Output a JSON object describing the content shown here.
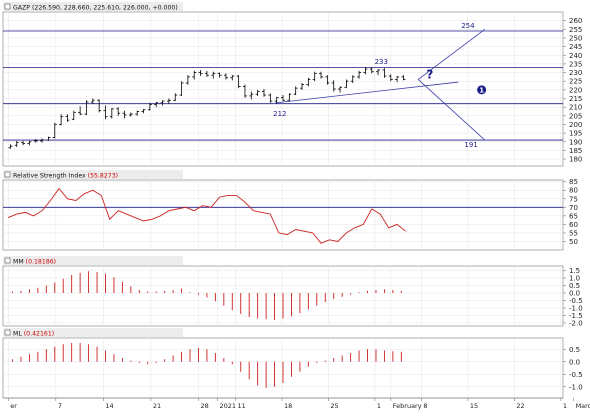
{
  "colors": {
    "background": "#ffffff",
    "grid": "#e6e6e6",
    "border": "#7a7a7a",
    "price_bar": "#000000",
    "level_line": "#1c1c8a",
    "trendline": "#3a3aa8",
    "rsi_line": "#cc1f1f",
    "histogram": "#cc1f1f",
    "annotation_text": "#1c1c8a",
    "header_bg": "#ececec",
    "header_value": "#cc0000"
  },
  "chart_data": [
    {
      "type": "ohlc",
      "pane": "price",
      "header_name": "GAZP",
      "header_values": "(226.590, 228.660, 225.610, 226.000, +0.000)",
      "ylim": [
        176,
        265
      ],
      "yticks": [
        180,
        185,
        190,
        195,
        200,
        205,
        210,
        215,
        220,
        225,
        230,
        235,
        240,
        245,
        250,
        255,
        260
      ],
      "horizontal_levels": [
        191,
        212,
        233,
        254
      ],
      "annotations": [
        {
          "text": "254",
          "x": 24.5,
          "y": 257
        },
        {
          "text": "233",
          "x": 16.3,
          "y": 236
        },
        {
          "text": "212",
          "x": 6.7,
          "y": 206
        },
        {
          "text": "191",
          "x": 24.8,
          "y": 188
        },
        {
          "text": "?",
          "x": 20.9,
          "y": 229,
          "kind": "question-mark"
        },
        {
          "text": "1",
          "x": 25.8,
          "y": 220,
          "kind": "circled-number"
        }
      ],
      "trendlines": [
        {
          "from": [
            6.3,
            212.5
          ],
          "to": [
            23.6,
            224.5
          ]
        },
        {
          "from": [
            19.8,
            226
          ],
          "to": [
            26.1,
            255
          ]
        },
        {
          "from": [
            19.8,
            226
          ],
          "to": [
            26.1,
            191
          ]
        }
      ],
      "bars": [
        {
          "x": -18.8,
          "open": 186.5,
          "high": 188.5,
          "low": 186.0,
          "close": 187.5
        },
        {
          "x": -18.2,
          "open": 188.0,
          "high": 190.5,
          "low": 187.0,
          "close": 189.5
        },
        {
          "x": -17.6,
          "open": 189.5,
          "high": 190.5,
          "low": 188.0,
          "close": 189.0
        },
        {
          "x": -17.0,
          "open": 189.0,
          "high": 190.5,
          "low": 188.0,
          "close": 190.0
        },
        {
          "x": -16.4,
          "open": 190.5,
          "high": 191.5,
          "low": 189.5,
          "close": 190.5
        },
        {
          "x": -15.8,
          "open": 190.5,
          "high": 192.0,
          "low": 189.5,
          "close": 191.0
        },
        {
          "x": -15.2,
          "open": 191.0,
          "high": 193.0,
          "low": 190.5,
          "close": 192.5
        },
        {
          "x": -14.6,
          "open": 192.5,
          "high": 201.0,
          "low": 192.0,
          "close": 200.0
        },
        {
          "x": -14.0,
          "open": 200.0,
          "high": 206.0,
          "low": 199.5,
          "close": 204.5
        },
        {
          "x": -13.4,
          "open": 204.5,
          "high": 206.0,
          "low": 201.5,
          "close": 202.5
        },
        {
          "x": -12.8,
          "open": 203.0,
          "high": 208.0,
          "low": 202.5,
          "close": 207.0
        },
        {
          "x": -12.2,
          "open": 207.0,
          "high": 210.5,
          "low": 205.5,
          "close": 206.0
        },
        {
          "x": -11.6,
          "open": 206.0,
          "high": 214.0,
          "low": 205.5,
          "close": 213.0
        },
        {
          "x": -11.0,
          "open": 213.0,
          "high": 215.0,
          "low": 212.0,
          "close": 214.0
        },
        {
          "x": -10.4,
          "open": 214.0,
          "high": 214.5,
          "low": 207.0,
          "close": 208.0
        },
        {
          "x": -9.8,
          "open": 208.0,
          "high": 211.0,
          "low": 203.0,
          "close": 204.5
        },
        {
          "x": -9.2,
          "open": 204.5,
          "high": 209.5,
          "low": 203.5,
          "close": 209.0
        },
        {
          "x": -8.6,
          "open": 209.0,
          "high": 210.0,
          "low": 205.0,
          "close": 206.5
        },
        {
          "x": -8.0,
          "open": 206.5,
          "high": 208.0,
          "low": 203.5,
          "close": 205.5
        },
        {
          "x": -7.4,
          "open": 205.5,
          "high": 207.0,
          "low": 204.5,
          "close": 206.0
        },
        {
          "x": -6.8,
          "open": 206.0,
          "high": 208.0,
          "low": 205.0,
          "close": 207.5
        },
        {
          "x": -6.2,
          "open": 207.5,
          "high": 209.0,
          "low": 206.5,
          "close": 208.5
        },
        {
          "x": -5.6,
          "open": 208.5,
          "high": 212.5,
          "low": 208.0,
          "close": 211.5
        },
        {
          "x": -5.0,
          "open": 211.5,
          "high": 213.0,
          "low": 210.0,
          "close": 212.5
        },
        {
          "x": -4.4,
          "open": 212.5,
          "high": 214.0,
          "low": 211.0,
          "close": 213.5
        },
        {
          "x": -3.8,
          "open": 213.5,
          "high": 215.0,
          "low": 212.0,
          "close": 214.0
        },
        {
          "x": -3.2,
          "open": 214.0,
          "high": 218.0,
          "low": 213.5,
          "close": 217.0
        },
        {
          "x": -2.6,
          "open": 217.0,
          "high": 225.0,
          "low": 216.5,
          "close": 224.0
        },
        {
          "x": -2.0,
          "open": 224.0,
          "high": 228.5,
          "low": 223.0,
          "close": 227.5
        },
        {
          "x": -1.4,
          "open": 227.5,
          "high": 231.0,
          "low": 226.0,
          "close": 230.0
        },
        {
          "x": -0.8,
          "open": 230.0,
          "high": 231.5,
          "low": 228.0,
          "close": 229.5
        },
        {
          "x": -0.2,
          "open": 229.5,
          "high": 231.0,
          "low": 227.5,
          "close": 228.5
        },
        {
          "x": 0.4,
          "open": 228.5,
          "high": 230.5,
          "low": 226.5,
          "close": 229.5
        },
        {
          "x": 1.0,
          "open": 229.5,
          "high": 230.0,
          "low": 227.0,
          "close": 228.5
        },
        {
          "x": 1.6,
          "open": 228.5,
          "high": 229.5,
          "low": 226.0,
          "close": 227.0
        },
        {
          "x": 2.2,
          "open": 227.0,
          "high": 228.5,
          "low": 225.5,
          "close": 228.0
        },
        {
          "x": 2.8,
          "open": 228.0,
          "high": 228.5,
          "low": 221.0,
          "close": 222.0
        },
        {
          "x": 3.4,
          "open": 222.0,
          "high": 223.0,
          "low": 215.5,
          "close": 216.5
        },
        {
          "x": 4.0,
          "open": 216.5,
          "high": 219.0,
          "low": 214.5,
          "close": 217.5
        },
        {
          "x": 4.6,
          "open": 217.5,
          "high": 220.0,
          "low": 216.5,
          "close": 219.0
        },
        {
          "x": 5.2,
          "open": 219.0,
          "high": 220.5,
          "low": 216.0,
          "close": 217.0
        },
        {
          "x": 5.8,
          "open": 217.0,
          "high": 218.0,
          "low": 212.5,
          "close": 213.5
        },
        {
          "x": 6.4,
          "open": 213.5,
          "high": 216.0,
          "low": 212.0,
          "close": 215.5
        },
        {
          "x": 7.0,
          "open": 215.5,
          "high": 217.0,
          "low": 213.5,
          "close": 214.0
        },
        {
          "x": 7.6,
          "open": 214.0,
          "high": 218.0,
          "low": 213.5,
          "close": 217.5
        },
        {
          "x": 8.2,
          "open": 217.5,
          "high": 222.0,
          "low": 217.0,
          "close": 221.0
        },
        {
          "x": 8.8,
          "open": 221.0,
          "high": 224.0,
          "low": 220.0,
          "close": 223.0
        },
        {
          "x": 9.4,
          "open": 223.0,
          "high": 227.0,
          "low": 222.0,
          "close": 226.0
        },
        {
          "x": 10.0,
          "open": 226.0,
          "high": 230.5,
          "low": 225.0,
          "close": 229.5
        },
        {
          "x": 10.6,
          "open": 229.5,
          "high": 230.5,
          "low": 226.5,
          "close": 227.5
        },
        {
          "x": 11.2,
          "open": 227.5,
          "high": 228.5,
          "low": 223.0,
          "close": 224.0
        },
        {
          "x": 11.8,
          "open": 224.0,
          "high": 225.5,
          "low": 219.0,
          "close": 220.5
        },
        {
          "x": 12.4,
          "open": 220.5,
          "high": 222.0,
          "low": 218.5,
          "close": 221.5
        },
        {
          "x": 13.0,
          "open": 221.5,
          "high": 226.0,
          "low": 221.0,
          "close": 225.0
        },
        {
          "x": 13.6,
          "open": 225.0,
          "high": 228.5,
          "low": 224.0,
          "close": 227.5
        },
        {
          "x": 14.2,
          "open": 227.5,
          "high": 231.0,
          "low": 226.5,
          "close": 230.0
        },
        {
          "x": 14.8,
          "open": 230.0,
          "high": 233.0,
          "low": 229.0,
          "close": 232.0
        },
        {
          "x": 15.4,
          "open": 232.0,
          "high": 233.0,
          "low": 229.5,
          "close": 230.5
        },
        {
          "x": 16.0,
          "open": 230.5,
          "high": 232.0,
          "low": 228.5,
          "close": 231.5
        },
        {
          "x": 16.6,
          "open": 231.5,
          "high": 232.5,
          "low": 227.0,
          "close": 228.0
        },
        {
          "x": 17.2,
          "open": 228.0,
          "high": 229.0,
          "low": 225.0,
          "close": 226.0
        },
        {
          "x": 17.8,
          "open": 226.0,
          "high": 228.0,
          "low": 224.5,
          "close": 227.5
        },
        {
          "x": 18.4,
          "open": 227.5,
          "high": 228.5,
          "low": 225.5,
          "close": 226.0
        }
      ]
    },
    {
      "type": "line",
      "pane": "rsi",
      "header_name": "Relative Strength Index",
      "header_values": "(55.8273)",
      "ylim": [
        45,
        86
      ],
      "yticks": [
        50,
        55,
        60,
        65,
        70,
        75,
        80,
        85
      ],
      "reference_levels": [
        70
      ],
      "x": [
        -19.0,
        -18.2,
        -17.4,
        -16.6,
        -15.8,
        -15.0,
        -14.2,
        -13.4,
        -12.6,
        -11.8,
        -11.0,
        -10.2,
        -9.4,
        -8.6,
        -7.8,
        -7.0,
        -6.2,
        -5.4,
        -4.6,
        -3.8,
        -3.0,
        -2.2,
        -1.4,
        -0.6,
        0.2,
        1.0,
        1.8,
        2.6,
        3.4,
        4.2,
        5.0,
        5.8,
        6.6,
        7.4,
        8.2,
        9.0,
        9.8,
        10.6,
        11.4,
        12.2,
        13.0,
        13.8,
        14.6,
        15.4,
        16.2,
        17.0,
        17.8,
        18.6
      ],
      "values": [
        64,
        66,
        67,
        65,
        68,
        74,
        81,
        75,
        74,
        78,
        80,
        77,
        63,
        68,
        66,
        64,
        62,
        63,
        65,
        68,
        69,
        70,
        68,
        71,
        70,
        76,
        77,
        77,
        73,
        68,
        67,
        66,
        55,
        54,
        57,
        56,
        55,
        49,
        51,
        50,
        55,
        58,
        60,
        69,
        66,
        58,
        60,
        56
      ],
      "last_value": 55.8273
    },
    {
      "type": "bar",
      "pane": "mm",
      "header_name": "MM",
      "header_values": "(0.18186)",
      "ylim": [
        -2.2,
        1.8
      ],
      "yticks": [
        -2.0,
        -1.5,
        -1.0,
        -0.5,
        0.0,
        0.5,
        1.0,
        1.5
      ],
      "x": [
        -18.6,
        -17.8,
        -17.0,
        -16.2,
        -15.4,
        -14.6,
        -13.8,
        -13.0,
        -12.2,
        -11.4,
        -10.6,
        -9.8,
        -9.0,
        -8.2,
        -7.4,
        -6.6,
        -5.8,
        -5.0,
        -4.2,
        -3.4,
        -2.6,
        -1.8,
        -1.0,
        -0.2,
        0.6,
        1.4,
        2.2,
        3.0,
        3.8,
        4.6,
        5.4,
        6.2,
        7.0,
        7.8,
        8.6,
        9.4,
        10.2,
        11.0,
        11.8,
        12.6,
        13.4,
        14.2,
        15.0,
        15.8,
        16.6,
        17.4,
        18.2
      ],
      "values": [
        0.1,
        0.15,
        0.25,
        0.35,
        0.5,
        0.7,
        0.95,
        1.2,
        1.35,
        1.45,
        1.4,
        1.3,
        1.05,
        0.75,
        0.45,
        0.2,
        0.1,
        0.1,
        0.15,
        0.2,
        0.3,
        0.05,
        -0.1,
        -0.3,
        -0.55,
        -0.85,
        -1.15,
        -1.4,
        -1.6,
        -1.7,
        -1.75,
        -1.8,
        -1.7,
        -1.55,
        -1.35,
        -1.1,
        -0.85,
        -0.6,
        -0.4,
        -0.25,
        -0.1,
        0.05,
        0.15,
        0.2,
        0.25,
        0.2,
        0.15
      ],
      "last_value": 0.18186
    },
    {
      "type": "bar",
      "pane": "ml",
      "header_name": "ML",
      "header_values": "(0.42161)",
      "ylim": [
        -1.45,
        0.95
      ],
      "yticks": [
        -1.0,
        -0.5,
        0.0,
        0.5
      ],
      "x": [
        -18.6,
        -17.8,
        -17.0,
        -16.2,
        -15.4,
        -14.6,
        -13.8,
        -13.0,
        -12.2,
        -11.4,
        -10.6,
        -9.8,
        -9.0,
        -8.2,
        -7.4,
        -6.6,
        -5.8,
        -5.0,
        -4.2,
        -3.4,
        -2.6,
        -1.8,
        -1.0,
        -0.2,
        0.6,
        1.4,
        2.2,
        3.0,
        3.8,
        4.6,
        5.4,
        6.2,
        7.0,
        7.8,
        8.6,
        9.4,
        10.2,
        11.0,
        11.8,
        12.6,
        13.4,
        14.2,
        15.0,
        15.8,
        16.6,
        17.4,
        18.2
      ],
      "values": [
        0.1,
        0.2,
        0.3,
        0.4,
        0.5,
        0.6,
        0.7,
        0.75,
        0.75,
        0.7,
        0.6,
        0.45,
        0.3,
        0.15,
        0.05,
        -0.05,
        -0.1,
        -0.05,
        0.1,
        0.25,
        0.4,
        0.5,
        0.55,
        0.5,
        0.35,
        0.15,
        -0.1,
        -0.4,
        -0.7,
        -0.95,
        -1.05,
        -1.0,
        -0.85,
        -0.6,
        -0.4,
        -0.2,
        -0.05,
        0.05,
        0.15,
        0.25,
        0.35,
        0.45,
        0.5,
        0.5,
        0.45,
        0.42,
        0.4
      ],
      "last_value": 0.42161
    }
  ],
  "x_axis": {
    "xlim": [
      -19.5,
      33.5
    ],
    "tick_positions": [
      -19,
      -15,
      -10,
      -5,
      0,
      3,
      6,
      10,
      13,
      17,
      20,
      26,
      31
    ],
    "tick_labels": [
      "er",
      "7",
      "14",
      "21",
      "28",
      "2021",
      "11",
      "18",
      "25",
      "1",
      "8",
      "15",
      "22",
      "1",
      "8"
    ],
    "ticks": [
      {
        "x": -19.0,
        "label": "er"
      },
      {
        "x": -14.5,
        "label": "7"
      },
      {
        "x": -10.0,
        "label": "14"
      },
      {
        "x": -5.5,
        "label": "21"
      },
      {
        "x": -1.0,
        "label": "28"
      },
      {
        "x": 0.8,
        "label": "2021"
      },
      {
        "x": 2.5,
        "label": "11"
      },
      {
        "x": 6.9,
        "label": "18"
      },
      {
        "x": 11.3,
        "label": "25"
      },
      {
        "x": 15.7,
        "label": "1"
      },
      {
        "x": 17.2,
        "label": "February"
      },
      {
        "x": 20.1,
        "label": "8"
      },
      {
        "x": 24.5,
        "label": "15"
      },
      {
        "x": 28.9,
        "label": "22"
      },
      {
        "x": 33.3,
        "label": "1"
      },
      {
        "x": 34.5,
        "label": "March"
      }
    ]
  }
}
